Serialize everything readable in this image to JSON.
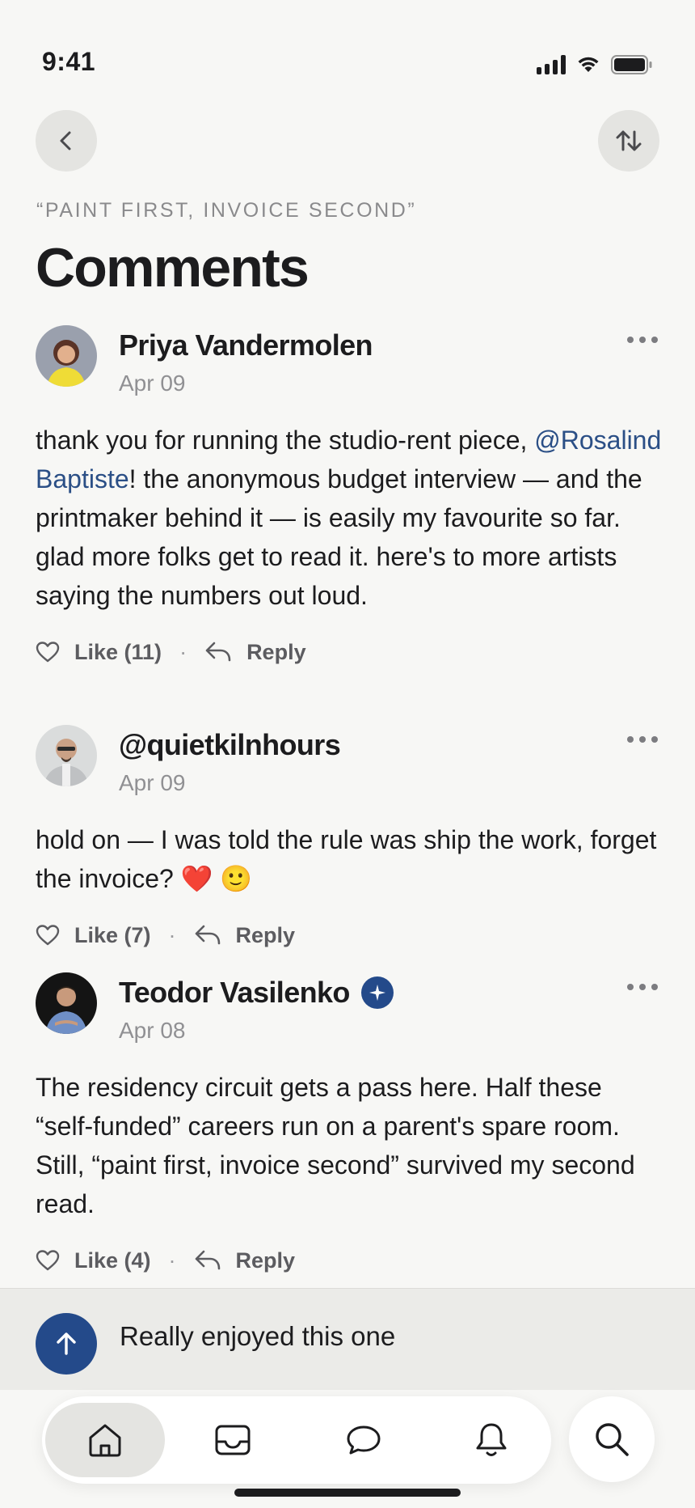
{
  "status_bar": {
    "time": "9:41"
  },
  "header": {
    "kicker": "“PAINT FIRST, INVOICE SECOND”",
    "title": "Comments"
  },
  "comments": [
    {
      "author": "Priya Vandermolen",
      "date": "Apr 09",
      "text_before": "thank you for running the studio-rent piece, ",
      "mention": "@Rosalind Baptiste",
      "text_after": "! the anonymous budget interview — and the printmaker behind it — is easily my favourite so far. glad more folks get to read it. here's to more artists saying the numbers out loud.",
      "like_label": "Like (11)",
      "reply_label": "Reply",
      "verified": false
    },
    {
      "author": "@quietkilnhours",
      "date": "Apr 09",
      "text_before": "hold on — I was told the rule was ship the work, forget the invoice? ❤️ 🙂",
      "mention": "",
      "text_after": "",
      "like_label": "Like (7)",
      "reply_label": "Reply",
      "verified": false
    },
    {
      "author": "Teodor Vasilenko",
      "date": "Apr 08",
      "text_before": "The residency circuit gets a pass here. Half these “self-funded” careers run on a parent's spare room. Still, “paint first, invoice second” survived my second read.",
      "mention": "",
      "text_after": "",
      "like_label": "Like (4)",
      "reply_label": "Reply",
      "verified": true
    }
  ],
  "composer": {
    "text": "Really enjoyed this one"
  },
  "tabbar": {
    "tabs": [
      {
        "icon": "home-icon",
        "active": true
      },
      {
        "icon": "inbox-icon",
        "active": false
      },
      {
        "icon": "chat-bubble-icon",
        "active": false
      },
      {
        "icon": "bell-icon",
        "active": false
      }
    ],
    "search_icon": "search-icon"
  },
  "colors": {
    "background": "#f7f7f5",
    "accent": "#244a8a",
    "mention": "#2b4f86",
    "muted": "#909093"
  }
}
